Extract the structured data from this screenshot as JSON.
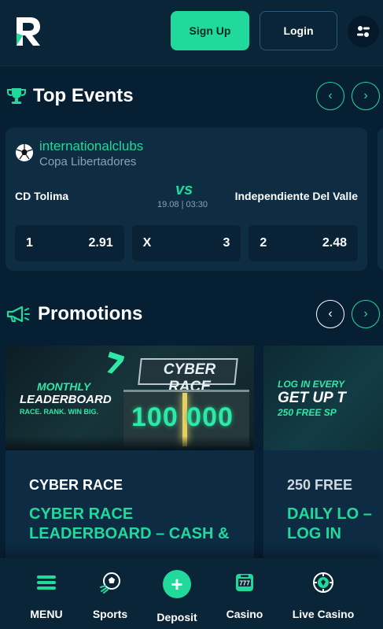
{
  "header": {
    "signup_label": "Sign Up",
    "login_label": "Login"
  },
  "top_events": {
    "title": "Top Events",
    "event": {
      "league": "internationalclubs",
      "competition": "Copa Libertadores",
      "home_team": "CD Tolima",
      "away_team": "Independiente Del Valle",
      "vs_label": "vs",
      "datetime": "19.08 | 03:30",
      "odds": [
        {
          "label": "1",
          "value": "2.91"
        },
        {
          "label": "X",
          "value": "3"
        },
        {
          "label": "2",
          "value": "2.48"
        }
      ]
    }
  },
  "promotions": {
    "title": "Promotions",
    "cards": [
      {
        "category": "CYBER RACE",
        "title": "CYBER RACE LEADERBOARD – CASH &",
        "banner": {
          "line1": "MONTHLY",
          "line2": "LEADERBOARD",
          "line3": "RACE. RANK. WIN BIG.",
          "sign": "CYBER RACE",
          "amount": "100 000"
        }
      },
      {
        "category": "250 FREE",
        "title": "DAILY LO – LOG IN",
        "banner": {
          "line1": "LOG IN EVERY",
          "line2": "GET UP T",
          "line3": "250 FREE SP"
        }
      }
    ]
  },
  "bottom_nav": {
    "items": [
      {
        "label": "MENU",
        "icon": "hamburger-icon"
      },
      {
        "label": "Sports",
        "icon": "soccer-ball-icon"
      },
      {
        "label": "Deposit",
        "icon": "plus-icon"
      },
      {
        "label": "Casino",
        "icon": "slot-machine-icon"
      },
      {
        "label": "Live Casino",
        "icon": "poker-chip-icon"
      }
    ]
  },
  "colors": {
    "accent": "#20d99b",
    "background": "#071f33",
    "card": "#0e2c42"
  }
}
